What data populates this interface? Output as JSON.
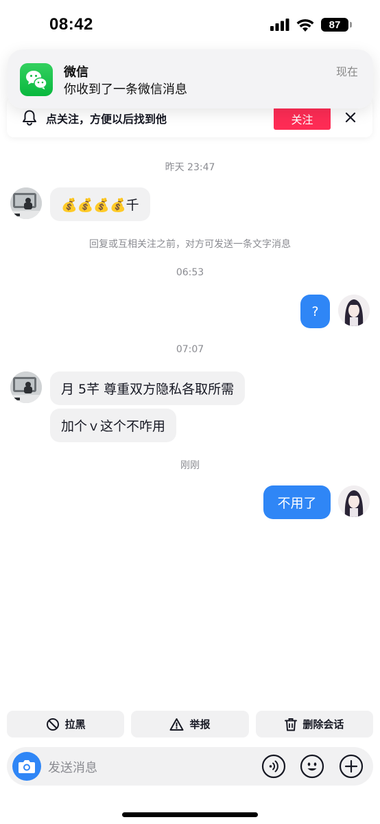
{
  "status_bar": {
    "time": "08:42",
    "battery": "87"
  },
  "notification": {
    "app": "微信",
    "message": "你收到了一条微信消息",
    "time": "现在"
  },
  "follow_banner": {
    "text": "点关注，方便以后找到他",
    "button": "关注"
  },
  "chat": {
    "timestamps": [
      "昨天 23:47",
      "06:53",
      "07:07",
      "刚刚"
    ],
    "system_notice": "回复或互相关注之前，对方可发送一条文字消息",
    "messages": [
      {
        "side": "left",
        "text": "💰💰💰💰千"
      },
      {
        "side": "right",
        "text": "?"
      },
      {
        "side": "left",
        "text": "月 5芊   尊重双方隐私各取所需"
      },
      {
        "side": "left",
        "text": "加个ｖ这个不咋用"
      },
      {
        "side": "right",
        "text": "不用了"
      }
    ]
  },
  "actions": {
    "block": "拉黑",
    "report": "举报",
    "delete": "删除会话"
  },
  "input": {
    "placeholder": "发送消息"
  },
  "colors": {
    "accent": "#2f86f6",
    "follow": "#fe2c55",
    "wechat": "#09b83e"
  }
}
